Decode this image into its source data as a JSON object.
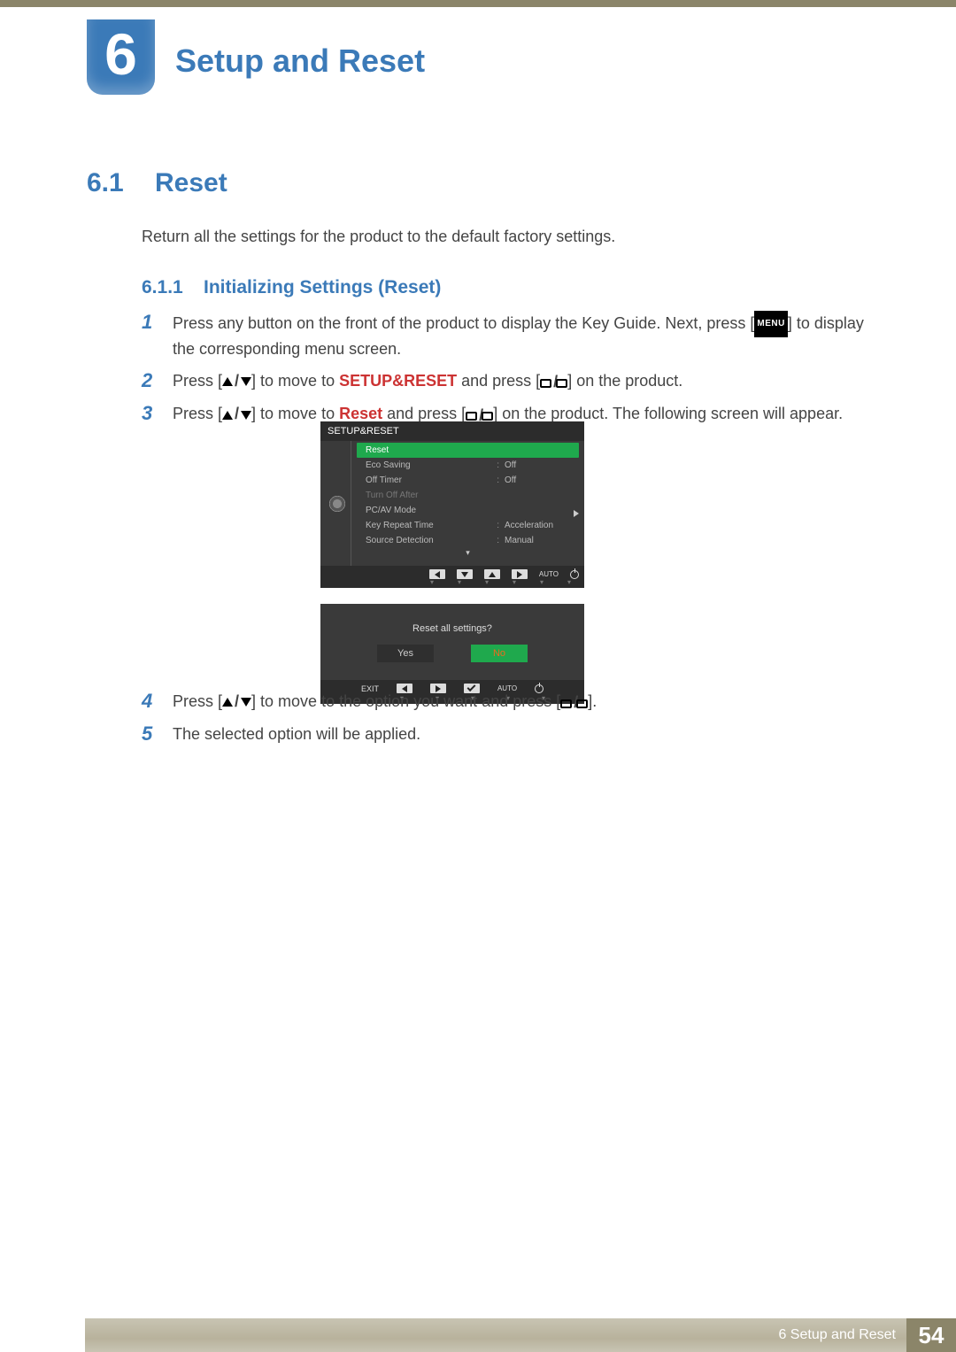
{
  "chapter": {
    "number": "6",
    "title": "Setup and Reset"
  },
  "section": {
    "number": "6.1",
    "title": "Reset"
  },
  "intro": "Return all the settings for the product to the default factory settings.",
  "subsection": {
    "number": "6.1.1",
    "title": "Initializing Settings (Reset)"
  },
  "steps": {
    "s1a": "Press any button on the front of the product to display the Key Guide. Next, press [",
    "s1b": "] to display the corresponding menu screen.",
    "menu_key": "MENU",
    "s2a": "Press [",
    "s2b": "] to move to ",
    "s2c": "SETUP&RESET",
    "s2d": " and press [",
    "s2e": "] on the product.",
    "s3a": "Press [",
    "s3b": "] to move to ",
    "s3c": "Reset",
    "s3d": " and press [",
    "s3e": "] on the product. The following screen will appear.",
    "s4a": "Press [",
    "s4b": "] to move to the option you want and press [",
    "s4c": "].",
    "s5": "The selected option will be applied."
  },
  "nums": {
    "n1": "1",
    "n2": "2",
    "n3": "3",
    "n4": "4",
    "n5": "5"
  },
  "osd1": {
    "title": "SETUP&RESET",
    "rows": [
      {
        "label": "Reset",
        "value": ""
      },
      {
        "label": "Eco Saving",
        "value": "Off"
      },
      {
        "label": "Off Timer",
        "value": "Off"
      },
      {
        "label": "Turn Off After",
        "value": ""
      },
      {
        "label": "PC/AV Mode",
        "value": ""
      },
      {
        "label": "Key Repeat Time",
        "value": "Acceleration"
      },
      {
        "label": "Source Detection",
        "value": "Manual"
      }
    ],
    "footer_auto": "AUTO"
  },
  "osd2": {
    "prompt": "Reset all settings?",
    "yes": "Yes",
    "no": "No",
    "exit": "EXIT",
    "footer_auto": "AUTO"
  },
  "footer": {
    "text": "6 Setup and Reset",
    "page": "54"
  }
}
